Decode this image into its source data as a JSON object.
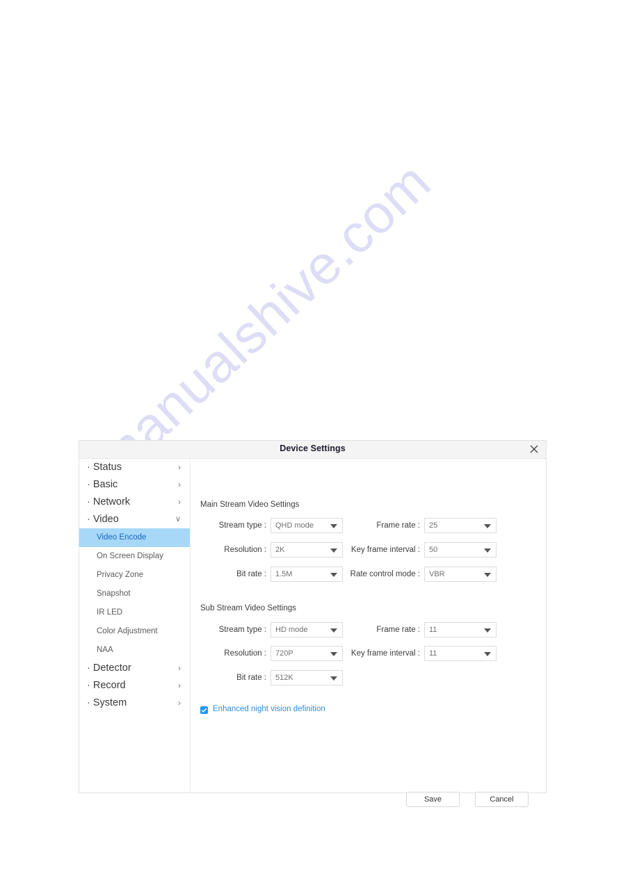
{
  "watermark": {
    "text": "manualshive.com"
  },
  "dialog": {
    "title": "Device Settings",
    "close_icon": "close-icon"
  },
  "sidebar": {
    "groups": [
      {
        "label": "Status",
        "chevron": "chevron-right-icon",
        "expanded": false
      },
      {
        "label": "Basic",
        "chevron": "chevron-right-icon",
        "expanded": false
      },
      {
        "label": "Network",
        "chevron": "chevron-right-icon",
        "expanded": false
      },
      {
        "label": "Video",
        "chevron": "chevron-down-icon",
        "expanded": true
      },
      {
        "label": "Detector",
        "chevron": "chevron-right-icon",
        "expanded": false
      },
      {
        "label": "Record",
        "chevron": "chevron-right-icon",
        "expanded": false
      },
      {
        "label": "System",
        "chevron": "chevron-right-icon",
        "expanded": false
      }
    ],
    "video_items": [
      {
        "label": "Video Encode",
        "active": true
      },
      {
        "label": "On Screen Display",
        "active": false
      },
      {
        "label": "Privacy Zone",
        "active": false
      },
      {
        "label": "Snapshot",
        "active": false
      },
      {
        "label": "IR LED",
        "active": false
      },
      {
        "label": "Color Adjustment",
        "active": false
      },
      {
        "label": "NAA",
        "active": false
      }
    ],
    "chevron_right_glyph": "›",
    "chevron_down_glyph": "∨",
    "bullet_glyph": "·"
  },
  "main_stream": {
    "heading": "Main Stream Video Settings",
    "stream_type": {
      "label": "Stream type :",
      "value": "QHD mode"
    },
    "resolution": {
      "label": "Resolution :",
      "value": "2K"
    },
    "bit_rate": {
      "label": "Bit rate :",
      "value": "1.5M"
    },
    "frame_rate": {
      "label": "Frame rate :",
      "value": "25"
    },
    "key_frame_interval": {
      "label": "Key frame interval :",
      "value": "50"
    },
    "rate_control_mode": {
      "label": "Rate control mode :",
      "value": "VBR"
    }
  },
  "sub_stream": {
    "heading": "Sub Stream Video Settings",
    "stream_type": {
      "label": "Stream type :",
      "value": "HD mode"
    },
    "resolution": {
      "label": "Resolution :",
      "value": "720P"
    },
    "bit_rate": {
      "label": "Bit rate :",
      "value": "512K"
    },
    "frame_rate": {
      "label": "Frame rate :",
      "value": "11"
    },
    "key_frame_interval": {
      "label": "Key frame interval :",
      "value": "11"
    }
  },
  "night_vision": {
    "label": "Enhanced night vision definition",
    "checked": true,
    "accent": "#2196f3"
  },
  "footer": {
    "save_label": "Save",
    "cancel_label": "Cancel"
  },
  "colors": {
    "active_nav_bg": "#a8d8f8",
    "active_nav_text": "#1565c0",
    "titlebar_bg": "#f4f4f4",
    "link_blue": "#2a8fe0"
  }
}
